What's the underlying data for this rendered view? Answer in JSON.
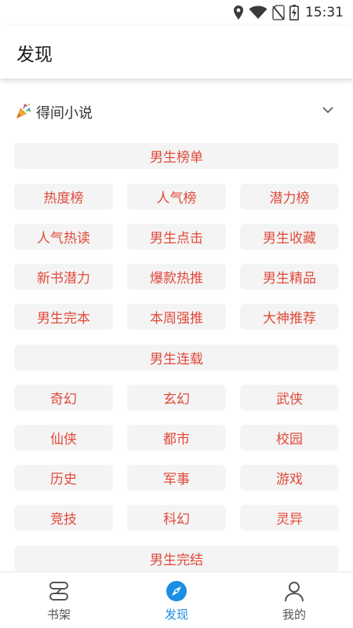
{
  "status_bar": {
    "time": "15:31"
  },
  "app_bar": {
    "title": "发现"
  },
  "section": {
    "title": "得间小说"
  },
  "groups": [
    {
      "header": "男生榜单",
      "items": [
        "热度榜",
        "人气榜",
        "潜力榜",
        "人气热读",
        "男生点击",
        "男生收藏",
        "新书潜力",
        "爆款热推",
        "男生精品",
        "男生完本",
        "本周强推",
        "大神推荐"
      ]
    },
    {
      "header": "男生连载",
      "items": [
        "奇幻",
        "玄幻",
        "武侠",
        "仙侠",
        "都市",
        "校园",
        "历史",
        "军事",
        "游戏",
        "竞技",
        "科幻",
        "灵异"
      ]
    },
    {
      "header": "男生完结",
      "items": []
    }
  ],
  "bottom_nav": [
    {
      "label": "书架",
      "icon": "bookshelf-icon",
      "active": false
    },
    {
      "label": "发现",
      "icon": "compass-icon",
      "active": true
    },
    {
      "label": "我的",
      "icon": "person-icon",
      "active": false
    }
  ],
  "colors": {
    "chip_text": "#e04a3a",
    "chip_bg": "#f4f4f4",
    "active_nav": "#1a8fe3",
    "nav_inactive": "#555555"
  }
}
